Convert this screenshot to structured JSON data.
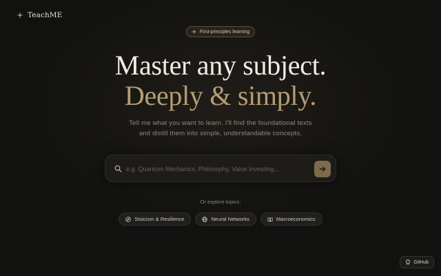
{
  "app": {
    "name": "TeachME"
  },
  "hero": {
    "badge": "First-principles learning",
    "title_line1": "Master any subject.",
    "title_line2": "Deeply & simply.",
    "subtitle_line1": "Tell me what you want to learn. I'll find the foundational texts",
    "subtitle_line2": "and distill them into simple, understandable concepts."
  },
  "search": {
    "placeholder": "e.g. Quantum Mechanics, Philosophy, Value Investing...",
    "value": ""
  },
  "explore": {
    "label": "Or explore topics:",
    "topics": [
      {
        "label": "Stoicism & Resilience",
        "icon": "compass-icon"
      },
      {
        "label": "Neural Networks",
        "icon": "globe-icon"
      },
      {
        "label": "Macroeconomics",
        "icon": "book-icon"
      }
    ]
  },
  "footer": {
    "github_label": "GitHub"
  },
  "colors": {
    "background": "#111110",
    "accent": "#b59c74",
    "submit_button": "#7f6a4c",
    "title": "#f1ece3"
  }
}
